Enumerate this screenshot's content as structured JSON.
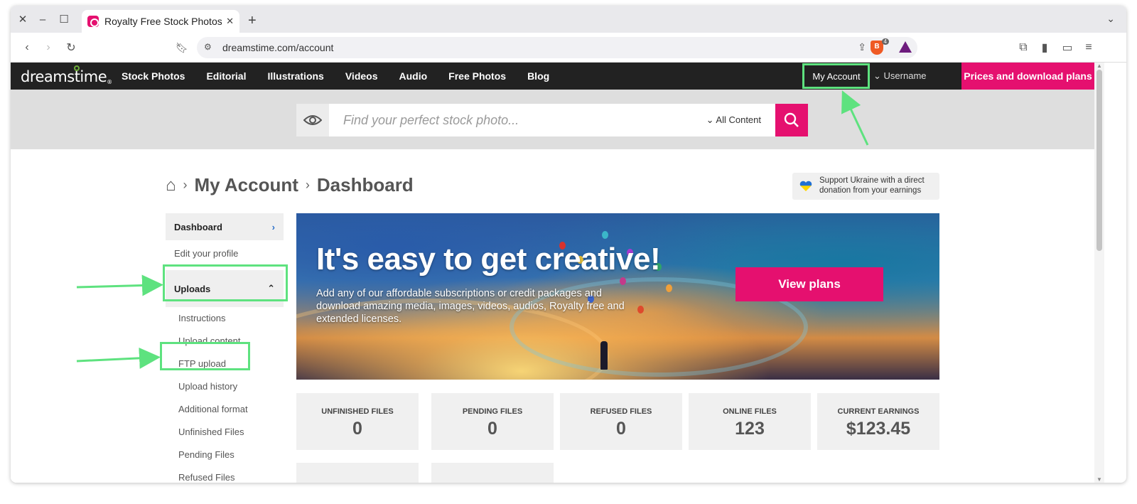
{
  "browser": {
    "tab_title": "Royalty Free Stock Photos",
    "url": "dreamstime.com/account",
    "shield_count": "4",
    "icons": [
      "close-window-icon",
      "minimize-icon",
      "maximize-icon",
      "new-tab-icon",
      "back-icon",
      "forward-icon",
      "reload-icon",
      "bookmark-icon",
      "site-settings-icon",
      "share-icon",
      "brave-shield-icon",
      "bat-icon",
      "extensions-icon",
      "sidebar-icon",
      "wallet-icon",
      "menu-icon"
    ]
  },
  "site": {
    "logo": "dreamstime",
    "nav": [
      "Stock Photos",
      "Editorial",
      "Illustrations",
      "Videos",
      "Audio",
      "Free Photos",
      "Blog"
    ],
    "my_account": "My Account",
    "username": "Username",
    "plans_button": "Prices and download plans",
    "search_placeholder": "Find your perfect stock photo...",
    "content_filter": "All Content",
    "accent_color": "#e5106f"
  },
  "breadcrumb": {
    "level1": "My Account",
    "level2": "Dashboard"
  },
  "ukraine": {
    "text": "Support Ukraine with a direct donation from your earnings"
  },
  "sidebar": {
    "dashboard": "Dashboard",
    "edit_profile": "Edit your profile",
    "uploads": "Uploads",
    "sub_items": [
      "Instructions",
      "Upload content",
      "FTP upload",
      "Upload history",
      "Additional format",
      "Unfinished Files",
      "Pending Files",
      "Refused Files"
    ]
  },
  "banner": {
    "title": "It's easy to get creative!",
    "text": "Add any of our affordable subscriptions or credit packages and download amazing media, images, videos, audios, Royalty free and extended licenses.",
    "button": "View plans"
  },
  "stats": [
    {
      "label": "UNFINISHED FILES",
      "value": "0"
    },
    {
      "label": "PENDING FILES",
      "value": "0"
    },
    {
      "label": "REFUSED FILES",
      "value": "0"
    },
    {
      "label": "ONLINE FILES",
      "value": "123"
    },
    {
      "label": "CURRENT EARNINGS",
      "value": "$123.45"
    }
  ],
  "annotation_color": "#5ee27f"
}
